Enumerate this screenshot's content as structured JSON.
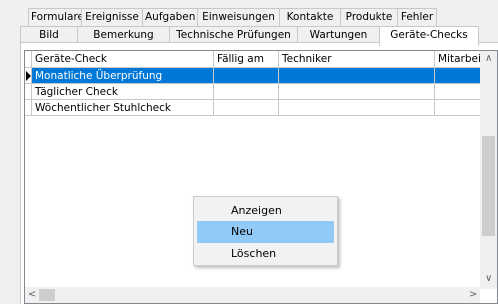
{
  "tabs": {
    "row1": [
      "Formulare",
      "Ereignisse",
      "Aufgaben",
      "Einweisungen",
      "Kontakte",
      "Produkte",
      "Fehler"
    ],
    "row2": [
      "Bild",
      "Bemerkung",
      "Technische Prüfungen",
      "Wartungen",
      "Geräte-Checks"
    ],
    "active": "Geräte-Checks"
  },
  "grid": {
    "columns": [
      "Geräte-Check",
      "Fällig am",
      "Techniker",
      "Mitarbeiter"
    ],
    "rows": [
      [
        "Monatliche Überprüfung",
        "",
        "",
        ""
      ],
      [
        "Täglicher Check",
        "",
        "",
        ""
      ],
      [
        "Wöchentlicher Stuhlcheck",
        "",
        "",
        ""
      ]
    ],
    "selected_row": 0
  },
  "context_menu": {
    "items": [
      "Anzeigen",
      "Neu",
      "Löschen"
    ],
    "highlighted": "Neu"
  },
  "colors": {
    "selection": "#0078d7",
    "menu_highlight": "#91c9f7"
  },
  "icons": {
    "row_indicator": "row-pointer-arrow",
    "scroll_up": "chevron-up-icon",
    "scroll_down": "chevron-down-icon",
    "scroll_left": "chevron-left-icon",
    "scroll_right": "chevron-right-icon"
  }
}
